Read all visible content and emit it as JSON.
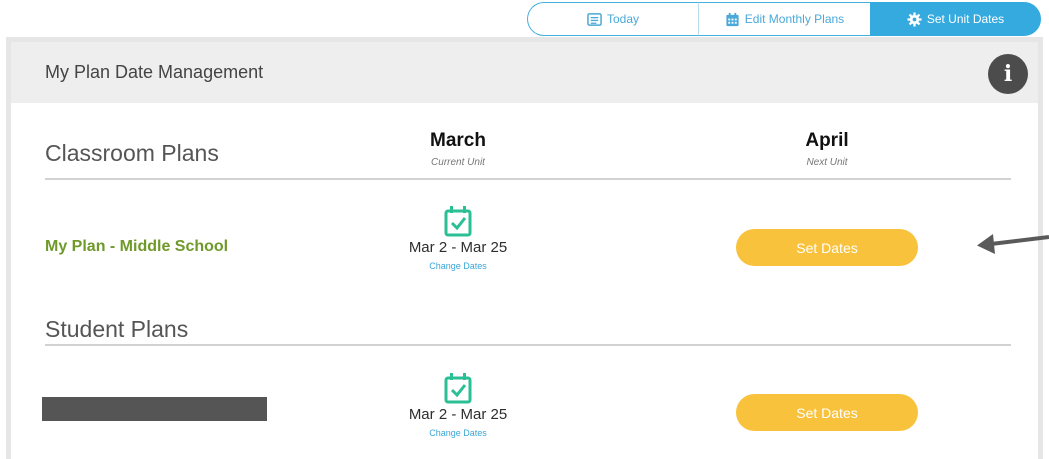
{
  "tabs": {
    "today": {
      "label": "Today",
      "icon": "list-icon"
    },
    "edit_monthly_plans": {
      "label": "Edit Monthly Plans",
      "icon": "calendar-grid-icon"
    },
    "set_unit_dates": {
      "label": "Set Unit Dates",
      "icon": "gear-icon",
      "active": true
    }
  },
  "panel": {
    "title": "My Plan Date Management",
    "info_icon": "info-icon",
    "info_label": "i"
  },
  "columns": {
    "current": {
      "month": "March",
      "label": "Current Unit"
    },
    "next": {
      "month": "April",
      "label": "Next Unit"
    }
  },
  "sections": {
    "classroom": {
      "title": "Classroom Plans",
      "plans": [
        {
          "name": "My Plan - Middle School",
          "current_dates": "Mar 2 - Mar 25",
          "change_label": "Change Dates",
          "next_button_label": "Set Dates"
        }
      ]
    },
    "student": {
      "title": "Student Plans",
      "plans": [
        {
          "name_redacted": true,
          "current_dates": "Mar 2 - Mar 25",
          "change_label": "Change Dates",
          "next_button_label": "Set Dates"
        }
      ]
    }
  },
  "colors": {
    "accent_blue": "#35aadf",
    "plan_green": "#6f9a2a",
    "set_button_yellow": "#f8c23c",
    "calendar_teal": "#2bbf96"
  }
}
